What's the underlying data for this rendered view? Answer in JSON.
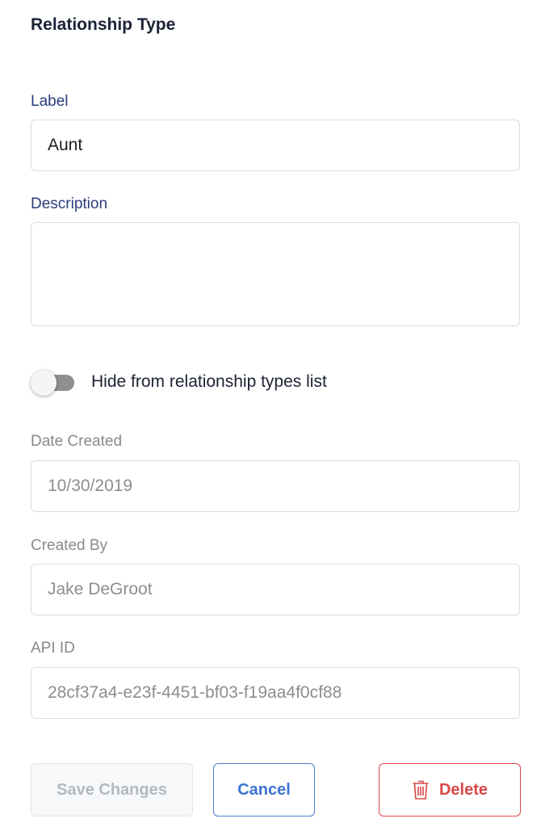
{
  "panel_title": "Relationship Type",
  "label_field": {
    "label": "Label",
    "value": "Aunt"
  },
  "description_field": {
    "label": "Description",
    "value": ""
  },
  "hide_toggle": {
    "label": "Hide from relationship types list",
    "checked": false
  },
  "date_created": {
    "label": "Date Created",
    "value": "10/30/2019"
  },
  "created_by": {
    "label": "Created By",
    "value": "Jake DeGroot"
  },
  "api_id": {
    "label": "API ID",
    "value": "28cf37a4-e23f-4451-bf03-f19aa4f0cf88"
  },
  "buttons": {
    "save": "Save Changes",
    "cancel": "Cancel",
    "delete": "Delete",
    "delete_icon": "trash-icon"
  },
  "colors": {
    "accent_blue": "#3e74d2",
    "danger_red": "#d94848",
    "label_blue": "#2a3d7d"
  }
}
